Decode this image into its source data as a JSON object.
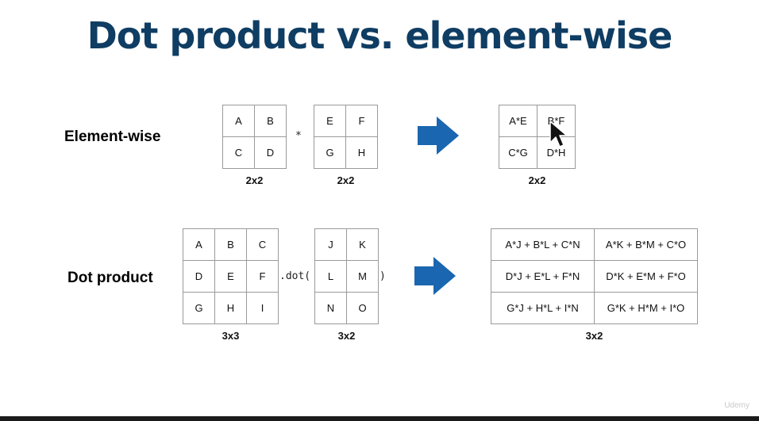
{
  "slide": {
    "title": "Dot product vs. element-wise",
    "watermark": "Udemy"
  },
  "elementwise": {
    "label": "Element-wise",
    "operator": "*",
    "matrix_a": {
      "cells": [
        "A",
        "B",
        "C",
        "D"
      ],
      "dim": "2x2"
    },
    "matrix_b": {
      "cells": [
        "E",
        "F",
        "G",
        "H"
      ],
      "dim": "2x2"
    },
    "result": {
      "cells": [
        "A*E",
        "B*F",
        "C*G",
        "D*H"
      ],
      "dim": "2x2"
    }
  },
  "dotproduct": {
    "label": "Dot product",
    "op_open": ".dot(",
    "op_close": ")",
    "matrix_a": {
      "cells": [
        "A",
        "B",
        "C",
        "D",
        "E",
        "F",
        "G",
        "H",
        "I"
      ],
      "dim": "3x3"
    },
    "matrix_b": {
      "cells": [
        "J",
        "K",
        "L",
        "M",
        "N",
        "O"
      ],
      "dim": "3x2"
    },
    "result": {
      "cells": [
        "A*J + B*L + C*N",
        "A*K + B*M + C*O",
        "D*J + E*L + F*N",
        "D*K + E*M + F*O",
        "G*J + H*L + I*N",
        "G*K + H*M + I*O"
      ],
      "dim": "3x2"
    }
  },
  "colors": {
    "title": "#0f3d63",
    "arrow": "#1a66b0",
    "grid": "#9a9a9a"
  },
  "icons": {
    "arrow": "right-arrow-icon",
    "cursor": "mouse-pointer-icon"
  }
}
